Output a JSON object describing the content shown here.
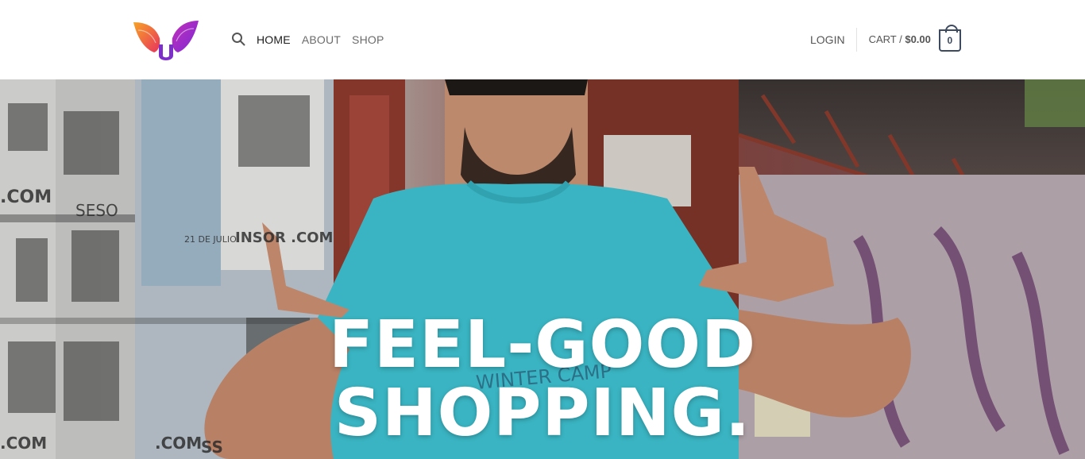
{
  "header": {
    "logo_icon": "wings-logo-icon",
    "search_icon": "search-icon",
    "nav": [
      {
        "label": "HOME",
        "active": true
      },
      {
        "label": "ABOUT",
        "active": false
      },
      {
        "label": "SHOP",
        "active": false
      }
    ],
    "login_label": "LOGIN",
    "cart": {
      "label": "CART / ",
      "amount": "$0.00",
      "count": "0",
      "icon": "cart-bag-icon"
    }
  },
  "hero": {
    "title_line1": "FEEL-GOOD",
    "title_line2": "SHOPPING.",
    "shirt_text": "WINTER CAMP",
    "poster_texts": [
      ".COM",
      "SESO",
      "21 DE JULIO",
      "INSOR .COM",
      ".COM",
      ".COM",
      "SS"
    ]
  },
  "colors": {
    "accent_dark": "#3d4a5f",
    "shirt": "#3ec0cf",
    "logo_orange": "#f5a623",
    "logo_purple": "#8e2ad6"
  }
}
